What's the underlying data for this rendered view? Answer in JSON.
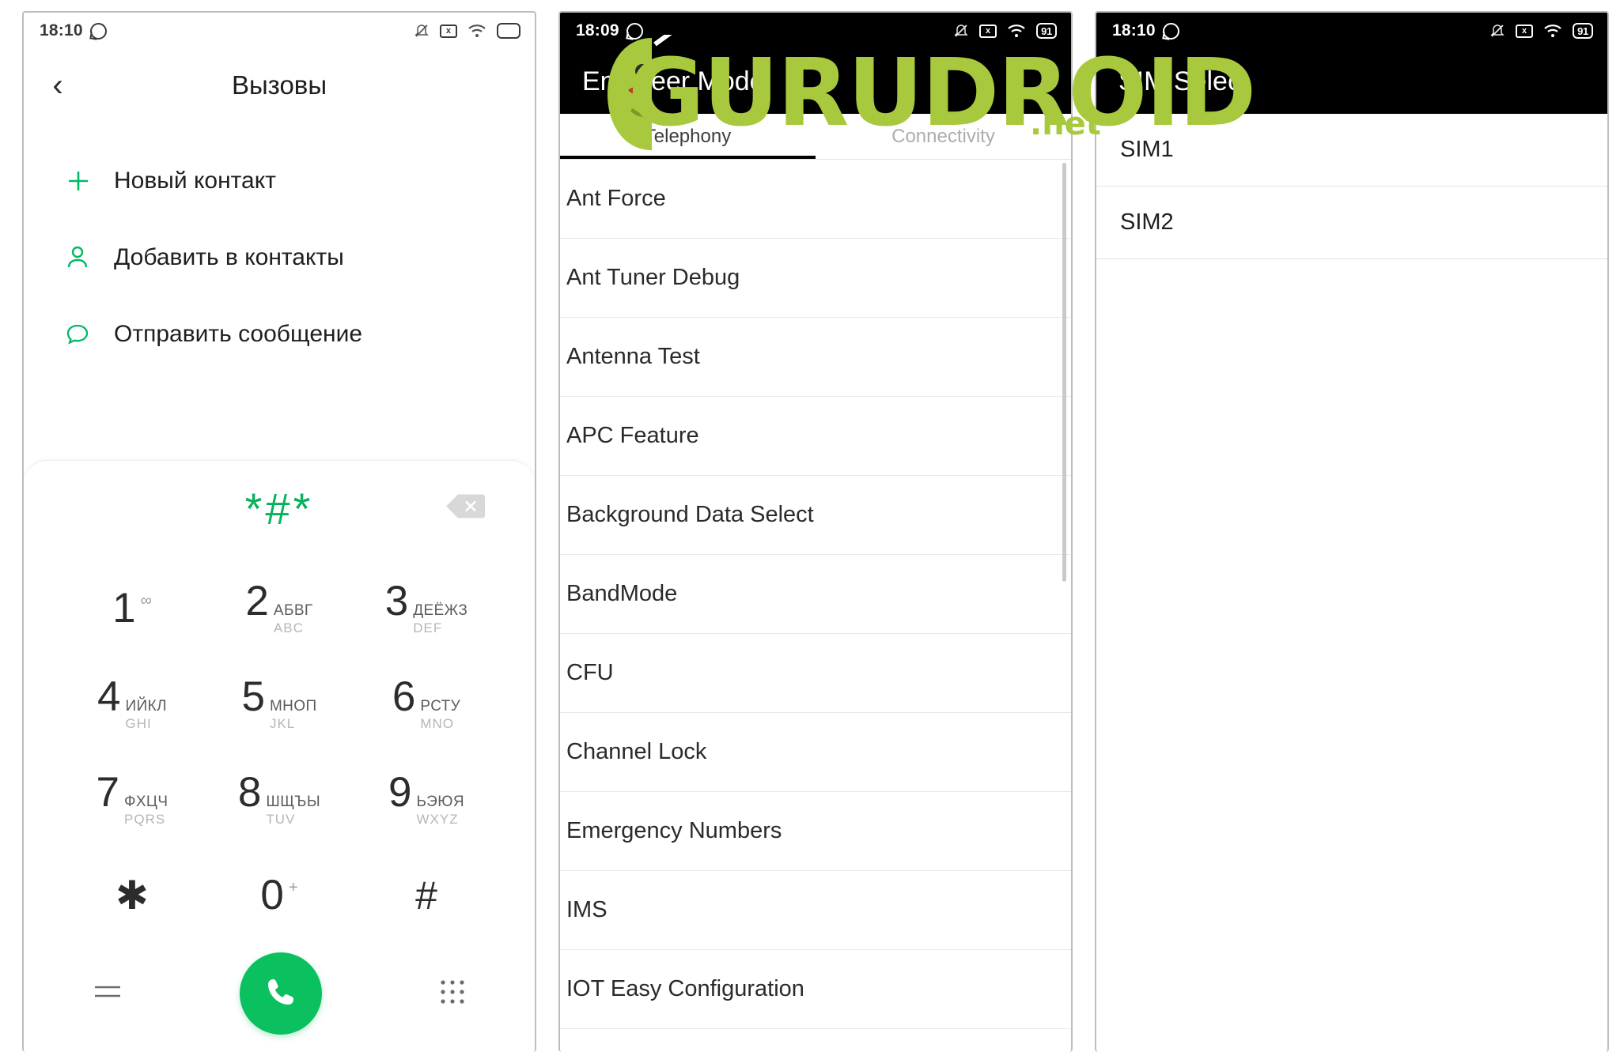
{
  "panel1": {
    "statusbar": {
      "time": "18:10",
      "icons": [
        "whatsapp-icon",
        "mute-icon",
        "screenshot-icon",
        "wifi-icon",
        "battery-icon"
      ]
    },
    "appbar": {
      "back": "‹",
      "title": "Вызовы"
    },
    "actions": [
      {
        "icon": "plus-icon",
        "label": "Новый контакт"
      },
      {
        "icon": "person-icon",
        "label": "Добавить в контакты"
      },
      {
        "icon": "message-icon",
        "label": "Отправить сообщение"
      }
    ],
    "dialpad": {
      "entry": "*#*",
      "backspace_icon": "backspace-icon",
      "keys": [
        {
          "digit": "1",
          "ru": "",
          "en": "",
          "sup": "∞"
        },
        {
          "digit": "2",
          "ru": "АБВГ",
          "en": "ABC",
          "sup": ""
        },
        {
          "digit": "3",
          "ru": "ДЕЁЖЗ",
          "en": "DEF",
          "sup": ""
        },
        {
          "digit": "4",
          "ru": "ИЙКЛ",
          "en": "GHI",
          "sup": ""
        },
        {
          "digit": "5",
          "ru": "МНОП",
          "en": "JKL",
          "sup": ""
        },
        {
          "digit": "6",
          "ru": "РСТУ",
          "en": "MNO",
          "sup": ""
        },
        {
          "digit": "7",
          "ru": "ФХЦЧ",
          "en": "PQRS",
          "sup": ""
        },
        {
          "digit": "8",
          "ru": "ШЩЪЫ",
          "en": "TUV",
          "sup": ""
        },
        {
          "digit": "9",
          "ru": "ЬЭЮЯ",
          "en": "WXYZ",
          "sup": ""
        },
        {
          "digit": "✱",
          "ru": "",
          "en": "",
          "sup": ""
        },
        {
          "digit": "0",
          "ru": "",
          "en": "",
          "sup": "+"
        },
        {
          "digit": "#",
          "ru": "",
          "en": "",
          "sup": ""
        }
      ],
      "bottom": {
        "menu_icon": "menu-icon",
        "call_icon": "call-icon",
        "keypad_icon": "keypad-icon"
      }
    }
  },
  "panel2": {
    "statusbar": {
      "time": "18:09",
      "battery": "91",
      "icons": [
        "whatsapp-icon",
        "mute-icon",
        "screenshot-icon",
        "wifi-icon",
        "battery-icon"
      ]
    },
    "appbar": {
      "title": "Engineer Mode"
    },
    "tabs": [
      {
        "label": "Telephony",
        "active": true
      },
      {
        "label": "Connectivity",
        "active": false
      }
    ],
    "list": [
      "Ant Force",
      "Ant Tuner Debug",
      "Antenna Test",
      "APC Feature",
      "Background Data Select",
      "BandMode",
      "CFU",
      "Channel Lock",
      "Emergency Numbers",
      "IMS",
      "IOT Easy Configuration"
    ]
  },
  "panel3": {
    "statusbar": {
      "time": "18:10",
      "battery": "91",
      "icons": [
        "whatsapp-icon",
        "mute-icon",
        "screenshot-icon",
        "wifi-icon",
        "battery-icon"
      ]
    },
    "appbar": {
      "title": "SIM Select"
    },
    "items": [
      "SIM1",
      "SIM2"
    ]
  },
  "watermark": {
    "text": "GURUDROID",
    "suffix": ".net",
    "color": "#a8c93d"
  }
}
